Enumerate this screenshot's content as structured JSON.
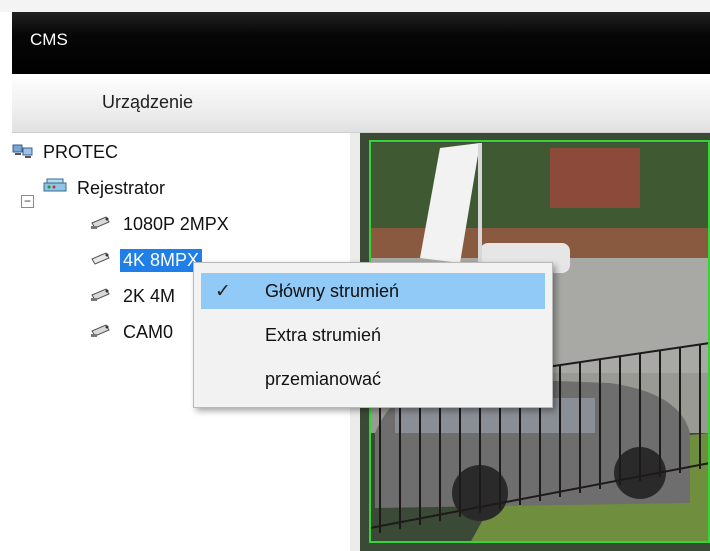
{
  "window": {
    "title": "CMS"
  },
  "toolbar": {
    "tab_label": "Urządzenie"
  },
  "tree": {
    "root": {
      "label": "PROTEC",
      "icon": "network-group-icon"
    },
    "recorder": {
      "label": "Rejestrator",
      "icon": "recorder-icon",
      "expanded": true
    },
    "cameras": [
      {
        "label": "1080P 2MPX",
        "icon": "camera-icon",
        "selected": false
      },
      {
        "label": "4K 8MPX",
        "icon": "camera-icon",
        "selected": true
      },
      {
        "label": "2K 4M",
        "icon": "camera-icon",
        "selected": false
      },
      {
        "label": "CAM0",
        "icon": "camera-icon",
        "selected": false
      }
    ]
  },
  "context_menu": {
    "items": [
      {
        "label": "Główny strumień",
        "checked": true,
        "highlighted": true
      },
      {
        "label": "Extra strumień",
        "checked": false,
        "highlighted": false
      },
      {
        "label": "przemianować",
        "checked": false,
        "highlighted": false
      }
    ]
  },
  "colors": {
    "selection": "#1f7ee8",
    "menu_highlight": "#91c9f7",
    "video_border": "#33d633",
    "titlebar": "#000000"
  }
}
